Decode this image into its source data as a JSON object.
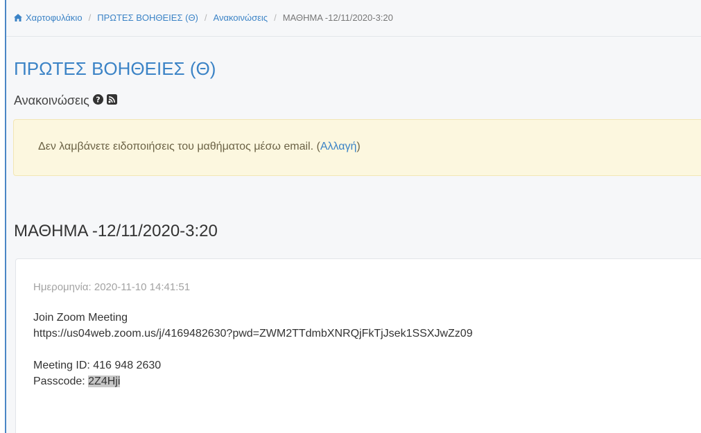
{
  "breadcrumb": {
    "items": [
      "Χαρτοφυλάκιο",
      "ΠΡΩΤΕΣ ΒΟΗΘΕΙΕΣ (Θ)",
      "Ανακοινώσεις"
    ],
    "separator": "/",
    "current": "ΜΑΘΗΜΑ -12/11/2020-3:20"
  },
  "course": {
    "title": "ΠΡΩΤΕΣ ΒΟΗΘΕΙΕΣ (Θ)"
  },
  "section": {
    "title": "Ανακοινώσεις",
    "icons": [
      "help-icon",
      "rss-icon"
    ]
  },
  "alert": {
    "text": "Δεν λαμβάνετε ειδοποιήσεις του μαθήματος μέσω email. (",
    "link": "Αλλαγή",
    "text_end": ")"
  },
  "announcement": {
    "title": "ΜΑΘΗΜΑ -12/11/2020-3:20",
    "date": "Ημερομηνία: 2020-11-10 14:41:51",
    "join_label": "Join Zoom Meeting",
    "url": "https://us04web.zoom.us/j/4169482630?pwd=ZWM2TTdmbXNRQjFkTjJsek1SSXJwZz09",
    "meeting_id": "Meeting ID: 416 948 2630",
    "passcode_label": "Passcode: ",
    "passcode_value": "2Z4Hji"
  },
  "colors": {
    "link": "#3b83c6",
    "alert_bg": "#fcf7df",
    "left_rule": "#4a86c5"
  }
}
